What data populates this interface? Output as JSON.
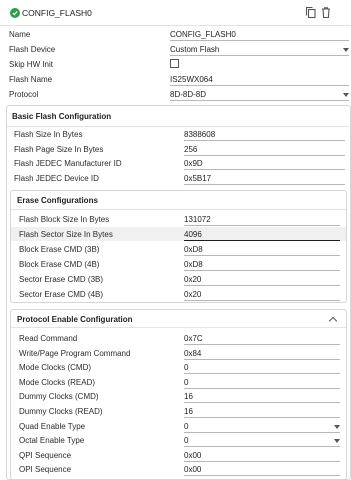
{
  "header": {
    "title": "CONFIG_FLASH0",
    "status_icon": "check-circle-icon",
    "copy_icon": "copy-icon",
    "delete_icon": "trash-icon"
  },
  "top_fields": [
    {
      "label": "Name",
      "value": "CONFIG_FLASH0",
      "type": "text"
    },
    {
      "label": "Flash Device",
      "value": "Custom Flash",
      "type": "select"
    },
    {
      "label": "Skip HW Init",
      "value": "",
      "type": "checkbox"
    },
    {
      "label": "Flash Name",
      "value": "IS25WX064",
      "type": "text"
    },
    {
      "label": "Protocol",
      "value": "8D-8D-8D",
      "type": "select"
    }
  ],
  "basic": {
    "title": "Basic Flash Configuration",
    "fields": [
      {
        "label": "Flash Size In Bytes",
        "value": "8388608"
      },
      {
        "label": "Flash Page Size In Bytes",
        "value": "256"
      },
      {
        "label": "Flash JEDEC Manufacturer ID",
        "value": "0x9D"
      },
      {
        "label": "Flash JEDEC Device ID",
        "value": "0x5B17"
      }
    ]
  },
  "erase": {
    "title": "Erase Configurations",
    "fields": [
      {
        "label": "Flash Block Size In Bytes",
        "value": "131072"
      },
      {
        "label": "Flash Sector Size In Bytes",
        "value": "4096"
      },
      {
        "label": "Block Erase CMD (3B)",
        "value": "0xD8"
      },
      {
        "label": "Block Erase CMD (4B)",
        "value": "0xD8"
      },
      {
        "label": "Sector Erase CMD (3B)",
        "value": "0x20"
      },
      {
        "label": "Sector Erase CMD (4B)",
        "value": "0x20"
      }
    ]
  },
  "protocol": {
    "title": "Protocol Enable Configuration",
    "fields": [
      {
        "label": "Read Command",
        "value": "0x7C"
      },
      {
        "label": "Write/Page Program Command",
        "value": "0x84"
      },
      {
        "label": "Mode Clocks (CMD)",
        "value": "0"
      },
      {
        "label": "Mode Clocks (READ)",
        "value": "0"
      },
      {
        "label": "Dummy Clocks (CMD)",
        "value": "16"
      },
      {
        "label": "Dummy Clocks (READ)",
        "value": "16"
      },
      {
        "label": "Quad Enable Type",
        "value": "0"
      },
      {
        "label": "Octal Enable Type",
        "value": "0"
      },
      {
        "label": "QPI Sequence",
        "value": "0x00"
      },
      {
        "label": "OPI Sequence",
        "value": "0x00"
      }
    ]
  }
}
